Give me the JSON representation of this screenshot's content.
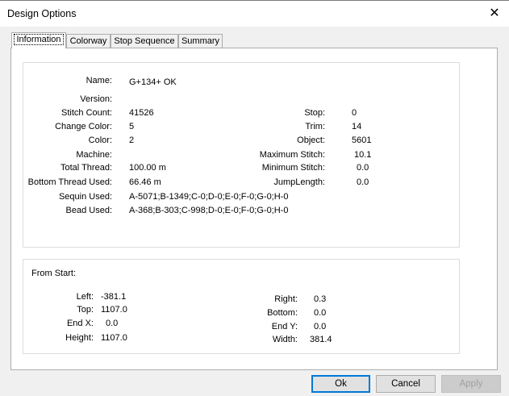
{
  "window": {
    "title": "Design Options",
    "close_glyph": "✕"
  },
  "tabs": [
    {
      "label": "Information"
    },
    {
      "label": "Colorway"
    },
    {
      "label": "Stop Sequence"
    },
    {
      "label": "Summary"
    }
  ],
  "info": {
    "name": {
      "label": "Name:",
      "value": "G+134+ OK"
    },
    "version": {
      "label": "Version:",
      "value": ""
    },
    "stitch_count": {
      "label": "Stitch Count:",
      "value": "41526"
    },
    "change_color": {
      "label": "Change Color:",
      "value": "5"
    },
    "color": {
      "label": "Color:",
      "value": "2"
    },
    "machine": {
      "label": "Machine:",
      "value": ""
    },
    "total_thread": {
      "label": "Total Thread:",
      "value": "100.00 m"
    },
    "bottom_thread": {
      "label": "Bottom Thread Used:",
      "value": "66.46 m"
    },
    "sequin": {
      "label": "Sequin Used:",
      "value": "A-5071;B-1349;C-0;D-0;E-0;F-0;G-0;H-0"
    },
    "bead": {
      "label": "Bead Used:",
      "value": "A-368;B-303;C-998;D-0;E-0;F-0;G-0;H-0"
    },
    "stop": {
      "label": "Stop:",
      "value": "0"
    },
    "trim": {
      "label": "Trim:",
      "value": "14"
    },
    "object": {
      "label": "Object:",
      "value": "5601"
    },
    "max_stitch": {
      "label": "Maximum Stitch:",
      "value": "10.1"
    },
    "min_stitch": {
      "label": "Minimum Stitch:",
      "value": "0.0"
    },
    "jump_length": {
      "label": "JumpLength:",
      "value": "0.0"
    }
  },
  "start": {
    "heading": "From Start:",
    "left": {
      "label": "Left:",
      "value": "-381.1"
    },
    "top": {
      "label": "Top:",
      "value": "1107.0"
    },
    "end_x": {
      "label": "End X:",
      "value": "0.0"
    },
    "height": {
      "label": "Height:",
      "value": "1107.0"
    },
    "right": {
      "label": "Right:",
      "value": "0.3"
    },
    "bottom": {
      "label": "Bottom:",
      "value": "0.0"
    },
    "end_y": {
      "label": "End Y:",
      "value": "0.0"
    },
    "width": {
      "label": "Width:",
      "value": "381.4"
    }
  },
  "buttons": {
    "ok": "Ok",
    "cancel": "Cancel",
    "apply": "Apply"
  }
}
